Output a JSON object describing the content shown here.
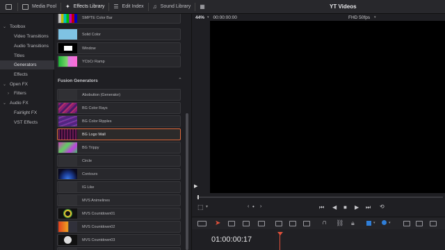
{
  "topbar": {
    "media_pool": "Media Pool",
    "effects_library": "Effects Library",
    "edit_index": "Edit Index",
    "sound_library": "Sound Library",
    "project_title": "YT Videos"
  },
  "sidebar": {
    "items": [
      {
        "label": "Toolbox",
        "expanded": true
      },
      {
        "label": "Video Transitions"
      },
      {
        "label": "Audio Transitions"
      },
      {
        "label": "Titles"
      },
      {
        "label": "Generators",
        "selected": true
      },
      {
        "label": "Effects"
      },
      {
        "label": "Open FX",
        "expanded": true
      },
      {
        "label": "Filters",
        "collapsed": true
      },
      {
        "label": "Audio FX",
        "expanded": true
      },
      {
        "label": "Fairlight FX"
      },
      {
        "label": "VST Effects"
      }
    ]
  },
  "library": {
    "top_items": [
      {
        "label": "SMPTE Color Bar"
      },
      {
        "label": "Solid Color"
      },
      {
        "label": "Window"
      },
      {
        "label": "YCbCr Ramp"
      }
    ],
    "fusion_header": "Fusion Generators",
    "fusion_items": [
      {
        "label": "Abobutton (Generator)"
      },
      {
        "label": "BG Color Rays"
      },
      {
        "label": "BG Color Ripples"
      },
      {
        "label": "BG Logo Wall",
        "selected": true
      },
      {
        "label": "BG Trippy"
      },
      {
        "label": "Circle"
      },
      {
        "label": "Contours"
      },
      {
        "label": "IG Like"
      },
      {
        "label": "MVS Animelines"
      },
      {
        "label": "MVS Countdown01"
      },
      {
        "label": "MVS Countdown02"
      },
      {
        "label": "MVS Countdown03"
      }
    ]
  },
  "viewer": {
    "zoom": "44%",
    "timecode": "00:00:00:00",
    "format": "FHD 50fps"
  },
  "timeline": {
    "timecode": "01:00:00:17"
  },
  "colors": {
    "selection_border": "#e06a3c",
    "playhead": "#e0503a",
    "accent_blue": "#2f7ed8"
  }
}
